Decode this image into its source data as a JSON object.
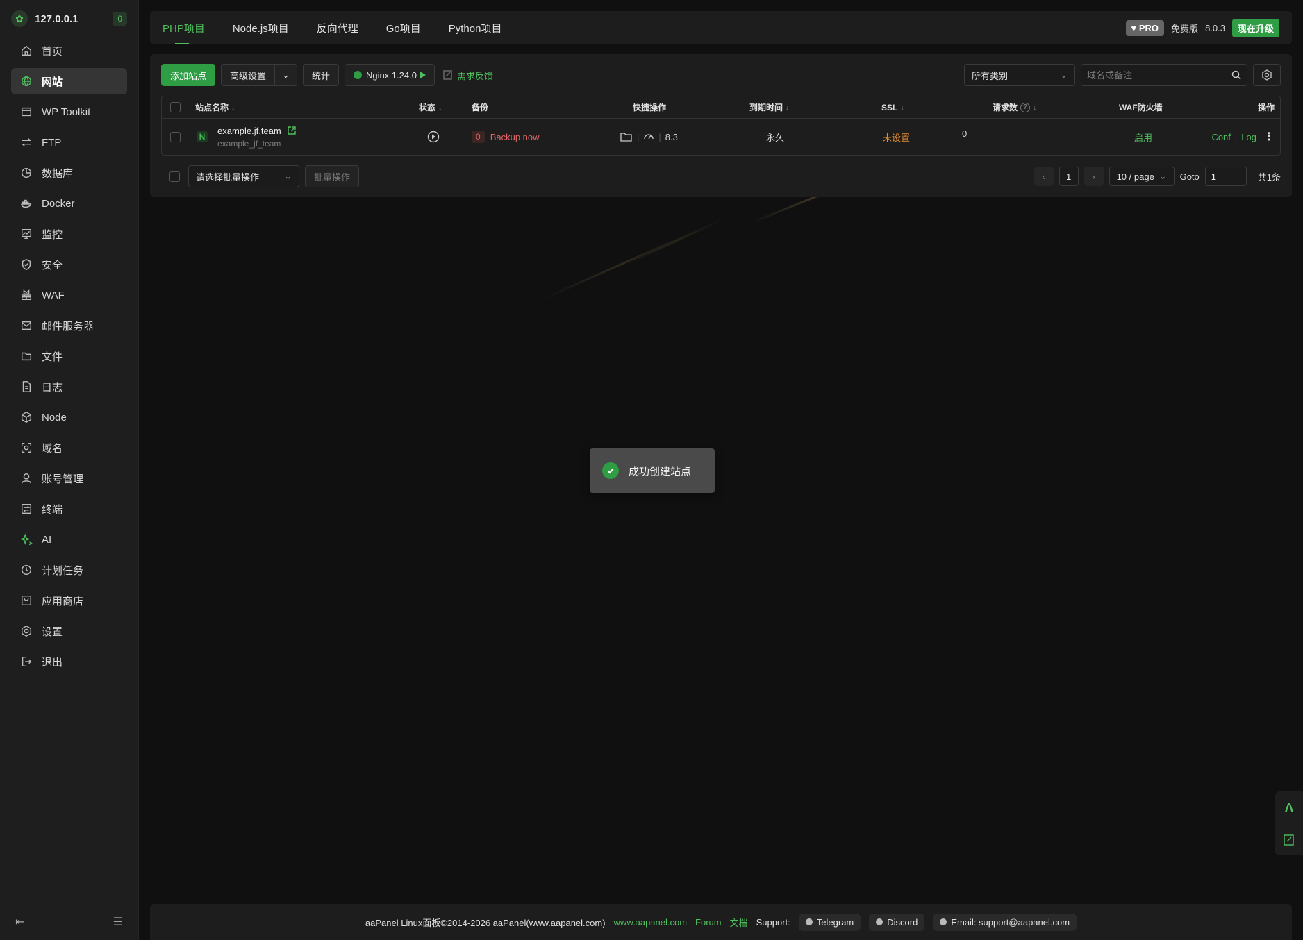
{
  "sidebar": {
    "ip": "127.0.0.1",
    "badge": "0",
    "items": [
      {
        "label": "首页",
        "icon": "home-icon"
      },
      {
        "label": "网站",
        "icon": "globe-icon",
        "active": true
      },
      {
        "label": "WP Toolkit",
        "icon": "wp-icon"
      },
      {
        "label": "FTP",
        "icon": "ftp-icon"
      },
      {
        "label": "数据库",
        "icon": "database-icon"
      },
      {
        "label": "Docker",
        "icon": "docker-icon"
      },
      {
        "label": "监控",
        "icon": "monitor-icon"
      },
      {
        "label": "安全",
        "icon": "shield-icon"
      },
      {
        "label": "WAF",
        "icon": "waf-icon"
      },
      {
        "label": "邮件服务器",
        "icon": "mail-icon"
      },
      {
        "label": "文件",
        "icon": "folder-icon"
      },
      {
        "label": "日志",
        "icon": "log-icon"
      },
      {
        "label": "Node",
        "icon": "node-icon"
      },
      {
        "label": "域名",
        "icon": "domain-icon"
      },
      {
        "label": "账号管理",
        "icon": "user-icon"
      },
      {
        "label": "终端",
        "icon": "terminal-icon"
      },
      {
        "label": "AI",
        "icon": "ai-icon"
      },
      {
        "label": "计划任务",
        "icon": "clock-icon"
      },
      {
        "label": "应用商店",
        "icon": "store-icon"
      },
      {
        "label": "设置",
        "icon": "gear-icon"
      },
      {
        "label": "退出",
        "icon": "logout-icon"
      }
    ]
  },
  "tabs": [
    "PHP项目",
    "Node.js项目",
    "反向代理",
    "Go项目",
    "Python项目"
  ],
  "header": {
    "pro": "PRO",
    "free": "免费版",
    "version": "8.0.3",
    "upgrade": "现在升级"
  },
  "toolbar": {
    "add_site": "添加站点",
    "advanced": "高级设置",
    "stats": "统计",
    "nginx": "Nginx 1.24.0",
    "feedback": "需求反馈",
    "category": "所有类别",
    "search_placeholder": "域名或备注"
  },
  "table": {
    "headers": {
      "name": "站点名称",
      "status": "状态",
      "backup": "备份",
      "quick": "快捷操作",
      "expire": "到期时间",
      "ssl": "SSL",
      "requests": "请求数",
      "waf": "WAF防火墙",
      "ops": "操作"
    },
    "rows": [
      {
        "name": "example.jf.team",
        "sub": "example_jf_team",
        "backup_count": "0",
        "backup_link": "Backup now",
        "php": "8.3",
        "expire": "永久",
        "ssl": "未设置",
        "requests": "0",
        "waf": "启用",
        "conf": "Conf",
        "log": "Log"
      }
    ]
  },
  "bulk": {
    "select": "请选择批量操作",
    "button": "批量操作"
  },
  "pager": {
    "page": "1",
    "per_page": "10 / page",
    "goto": "Goto",
    "goto_value": "1",
    "total": "共1条"
  },
  "toast": {
    "message": "成功创建站点"
  },
  "footer": {
    "copyright": "aaPanel Linux面板©2014-2026 aaPanel(www.aapanel.com)",
    "site": "www.aapanel.com",
    "forum": "Forum",
    "docs": "文档",
    "support": "Support:",
    "telegram": "Telegram",
    "discord": "Discord",
    "email": "Email: support@aapanel.com"
  }
}
